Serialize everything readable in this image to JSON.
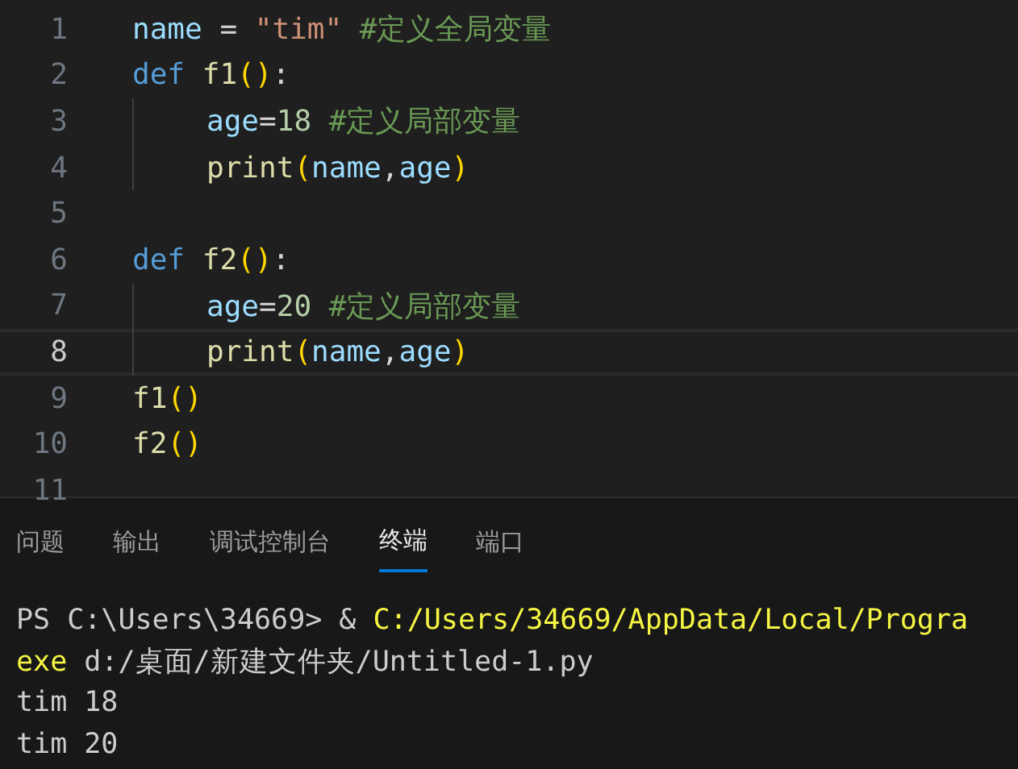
{
  "editor": {
    "lines": [
      {
        "number": "1",
        "current": false,
        "indented": false,
        "tokens": [
          {
            "kind": "variable",
            "text": "name"
          },
          {
            "kind": "plain",
            "text": " = "
          },
          {
            "kind": "string",
            "text": "\"tim\""
          },
          {
            "kind": "comment",
            "text": " #定义全局变量"
          }
        ]
      },
      {
        "number": "2",
        "current": false,
        "indented": false,
        "tokens": [
          {
            "kind": "keyword",
            "text": "def"
          },
          {
            "kind": "function",
            "text": " f1"
          },
          {
            "kind": "bracket",
            "text": "()"
          },
          {
            "kind": "plain",
            "text": ":"
          }
        ]
      },
      {
        "number": "3",
        "current": false,
        "indented": true,
        "tokens": [
          {
            "kind": "variable",
            "text": "age"
          },
          {
            "kind": "plain",
            "text": "="
          },
          {
            "kind": "number",
            "text": "18"
          },
          {
            "kind": "comment",
            "text": " #定义局部变量"
          }
        ]
      },
      {
        "number": "4",
        "current": false,
        "indented": true,
        "tokens": [
          {
            "kind": "function",
            "text": "print"
          },
          {
            "kind": "bracket",
            "text": "("
          },
          {
            "kind": "variable",
            "text": "name"
          },
          {
            "kind": "plain",
            "text": ","
          },
          {
            "kind": "variable",
            "text": "age"
          },
          {
            "kind": "bracket",
            "text": ")"
          }
        ]
      },
      {
        "number": "5",
        "current": false,
        "indented": false
      },
      {
        "number": "6",
        "current": false,
        "indented": false,
        "tokens": [
          {
            "kind": "keyword",
            "text": "def"
          },
          {
            "kind": "function",
            "text": " f2"
          },
          {
            "kind": "bracket",
            "text": "()"
          },
          {
            "kind": "plain",
            "text": ":"
          }
        ]
      },
      {
        "number": "7",
        "current": false,
        "indented": true,
        "tokens": [
          {
            "kind": "variable",
            "text": "age"
          },
          {
            "kind": "plain",
            "text": "="
          },
          {
            "kind": "number",
            "text": "20"
          },
          {
            "kind": "comment",
            "text": " #定义局部变量"
          }
        ]
      },
      {
        "number": "8",
        "current": true,
        "indented": true,
        "tokens": [
          {
            "kind": "function",
            "text": "print"
          },
          {
            "kind": "bracket",
            "text": "("
          },
          {
            "kind": "variable",
            "text": "name"
          },
          {
            "kind": "plain",
            "text": ","
          },
          {
            "kind": "variable",
            "text": "age"
          },
          {
            "kind": "bracket",
            "text": ")"
          }
        ]
      },
      {
        "number": "9",
        "current": false,
        "indented": false,
        "tokens": [
          {
            "kind": "function",
            "text": "f1"
          },
          {
            "kind": "bracket",
            "text": "()"
          }
        ]
      },
      {
        "number": "10",
        "current": false,
        "indented": false,
        "tokens": [
          {
            "kind": "function",
            "text": "f2"
          },
          {
            "kind": "bracket",
            "text": "()"
          }
        ]
      },
      {
        "number": "11",
        "current": false,
        "indented": false
      }
    ]
  },
  "panel": {
    "tabs": [
      {
        "label": "问题",
        "selected": false
      },
      {
        "label": "输出",
        "selected": false
      },
      {
        "label": "调试控制台",
        "selected": false
      },
      {
        "label": "终端",
        "selected": true
      },
      {
        "label": "端口",
        "selected": false
      }
    ],
    "terminal": [
      [
        {
          "kind": "plain",
          "text": "PS C:\\Users\\34669> & "
        },
        {
          "kind": "path",
          "text": "C:/Users/34669/AppData/Local/Progra"
        }
      ],
      [
        {
          "kind": "path",
          "text": "exe"
        },
        {
          "kind": "plain",
          "text": " d:/桌面/新建文件夹/Untitled-1.py"
        }
      ],
      [
        {
          "kind": "plain",
          "text": "tim 18"
        }
      ],
      [
        {
          "kind": "plain",
          "text": "tim 20"
        }
      ]
    ]
  }
}
